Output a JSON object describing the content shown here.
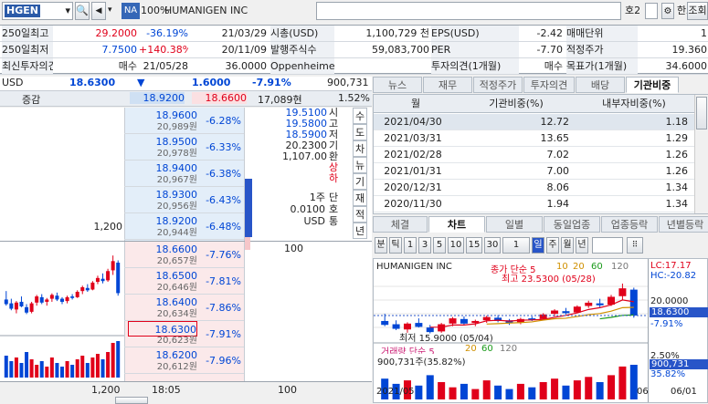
{
  "top": {
    "code": "HGEN",
    "na": "NA",
    "pct": "100%",
    "name": "HUMANIGEN INC",
    "screen_no": "호2",
    "hanto": "한도",
    "jo": "조회"
  },
  "summary": [
    [
      "250일최고",
      "29.2000",
      "-36.19%",
      "21/03/29",
      "시총(USD)",
      "1,100,729 천",
      "EPS(USD)",
      "-2.42",
      "매매단위",
      "1"
    ],
    [
      "250일최저",
      "7.7500",
      "+140.38%",
      "20/11/09",
      "발행주식수",
      "59,083,700",
      "PER",
      "-7.70",
      "적정주가",
      "19.360"
    ],
    [
      "최신투자의견",
      "매수",
      "21/05/28",
      "36.0000",
      "Oppenheimer Kevin DeGeeter",
      "",
      "투자의견(1개월)",
      "매수",
      "목표가(1개월)",
      "34.6000"
    ]
  ],
  "quote": {
    "currency": "USD",
    "price": "18.6300",
    "arrow": "▼",
    "change": "1.6000",
    "rate": "-7.91%",
    "volume": "900,731",
    "label_zg": "증감",
    "ask_top": "18.9200",
    "bid_top": "18.6600",
    "qty": "17,089현",
    "ratio": "1.52%"
  },
  "asks": [
    {
      "price": "18.9600",
      "rate": "-6.28%",
      "vol": "20,989원",
      "qty": ""
    },
    {
      "price": "18.9500",
      "rate": "-6.33%",
      "vol": "20,978원",
      "qty": ""
    },
    {
      "price": "18.9400",
      "rate": "-6.38%",
      "vol": "20,967원",
      "qty": ""
    },
    {
      "price": "18.9300",
      "rate": "-6.43%",
      "vol": "20,956원",
      "qty": ""
    },
    {
      "price": "18.9200",
      "rate": "-6.48%",
      "vol": "20,944원",
      "qty": "1,200"
    }
  ],
  "bids": [
    {
      "price": "18.6600",
      "rate": "-7.76%",
      "vol": "20,657원",
      "qty": "100"
    },
    {
      "price": "18.6500",
      "rate": "-7.81%",
      "vol": "20,646원",
      "qty": ""
    },
    {
      "price": "18.6400",
      "rate": "-7.86%",
      "vol": "20,634원",
      "qty": ""
    },
    {
      "price": "18.6300",
      "rate": "-7.91%",
      "vol": "20,623원",
      "qty": ""
    },
    {
      "price": "18.6200",
      "rate": "-7.96%",
      "vol": "20,612원",
      "qty": ""
    }
  ],
  "info": {
    "lines": [
      "19.5100",
      "19.5800",
      "18.5900",
      "20.2300",
      "1,107.00"
    ],
    "labels": [
      "시",
      "고",
      "저",
      "기",
      "환",
      "상",
      "하"
    ],
    "unit1": "1주",
    "unit2": "0.0100",
    "unit3": "USD",
    "lbl2": [
      "단",
      "호",
      "통"
    ],
    "mini_labels": [
      "수",
      "도",
      "차",
      "뉴",
      "기",
      "재",
      "적",
      "년"
    ]
  },
  "footer": {
    "qty": "1,200",
    "time": "18:05",
    "qty2": "100"
  },
  "right_tabs": [
    "뉴스",
    "재무",
    "적정주가",
    "투자의견",
    "배당",
    "기관비중"
  ],
  "table": {
    "headers": [
      "월",
      "기관비중(%)",
      "내부자비중(%)"
    ],
    "rows": [
      [
        "2021/04/30",
        "12.72",
        "1.18"
      ],
      [
        "2021/03/31",
        "13.65",
        "1.29"
      ],
      [
        "2021/02/28",
        "7.02",
        "1.26"
      ],
      [
        "2021/01/31",
        "7.00",
        "1.26"
      ],
      [
        "2020/12/31",
        "8.06",
        "1.34"
      ],
      [
        "2020/11/30",
        "1.94",
        "1.34"
      ]
    ]
  },
  "lower_tabs": [
    "체결",
    "차트",
    "일별",
    "동일업종",
    "업종등락",
    "년별등락"
  ],
  "chart_tools": [
    "분",
    "틱",
    "1",
    "3",
    "5",
    "10",
    "15",
    "30",
    "1",
    "일",
    "주",
    "월",
    "년"
  ],
  "chart": {
    "name": "HUMANIGEN INC",
    "ma_label": "종가 단순 5",
    "ma_nums": [
      "10",
      "20",
      "60",
      "120"
    ],
    "high": "최고 23.5300 (05/28)",
    "low": "최저 15.9000 (05/04)",
    "lc": "LC:17.17",
    "hc": "HC:-20.82",
    "y1": "20.0000",
    "price": "18.6300",
    "rate": "-7.91%",
    "vol_label": "거래량 단순 5",
    "vol_nums": [
      "20",
      "60",
      "120"
    ],
    "vol_val": "900,731주(35.82%)",
    "vol_pct": "2.50%",
    "vol_right": "900,731",
    "vol_right2": "35.82%",
    "x1": "2021/05",
    "x2": "06",
    "x3": "06/01"
  },
  "chart_data": {
    "type": "candlestick",
    "bars": [
      {
        "o": 17.8,
        "h": 18.9,
        "l": 17.0,
        "c": 17.2
      },
      {
        "o": 17.3,
        "h": 17.9,
        "l": 16.4,
        "c": 16.6
      },
      {
        "o": 16.5,
        "h": 17.6,
        "l": 16.0,
        "c": 17.4
      },
      {
        "o": 17.5,
        "h": 18.2,
        "l": 16.8,
        "c": 16.9
      },
      {
        "o": 16.8,
        "h": 17.2,
        "l": 15.9,
        "c": 16.1
      },
      {
        "o": 16.2,
        "h": 17.5,
        "l": 16.0,
        "c": 17.3
      },
      {
        "o": 17.4,
        "h": 18.4,
        "l": 17.0,
        "c": 18.2
      },
      {
        "o": 18.1,
        "h": 18.5,
        "l": 17.2,
        "c": 17.4
      },
      {
        "o": 17.5,
        "h": 18.0,
        "l": 17.0,
        "c": 17.8
      },
      {
        "o": 17.9,
        "h": 18.6,
        "l": 17.5,
        "c": 18.4
      },
      {
        "o": 18.3,
        "h": 18.7,
        "l": 17.6,
        "c": 17.8
      },
      {
        "o": 17.9,
        "h": 18.1,
        "l": 17.2,
        "c": 17.5
      },
      {
        "o": 17.6,
        "h": 18.3,
        "l": 17.3,
        "c": 18.1
      },
      {
        "o": 18.2,
        "h": 18.5,
        "l": 17.8,
        "c": 18.0
      },
      {
        "o": 18.1,
        "h": 19.0,
        "l": 18.0,
        "c": 18.8
      },
      {
        "o": 18.9,
        "h": 19.6,
        "l": 18.5,
        "c": 19.4
      },
      {
        "o": 19.3,
        "h": 19.8,
        "l": 18.8,
        "c": 19.0
      },
      {
        "o": 19.1,
        "h": 20.2,
        "l": 19.0,
        "c": 20.0
      },
      {
        "o": 20.1,
        "h": 20.9,
        "l": 19.8,
        "c": 20.6
      },
      {
        "o": 20.5,
        "h": 21.2,
        "l": 19.9,
        "c": 20.2
      },
      {
        "o": 20.3,
        "h": 21.8,
        "l": 20.1,
        "c": 21.5
      },
      {
        "o": 21.6,
        "h": 23.53,
        "l": 21.0,
        "c": 22.8
      },
      {
        "o": 22.6,
        "h": 22.9,
        "l": 18.3,
        "c": 18.63
      }
    ],
    "volumes": [
      60,
      45,
      55,
      40,
      70,
      50,
      35,
      45,
      30,
      55,
      40,
      30,
      45,
      35,
      50,
      60,
      40,
      55,
      65,
      50,
      70,
      95,
      100
    ],
    "ylim": [
      15,
      24.5
    ]
  }
}
